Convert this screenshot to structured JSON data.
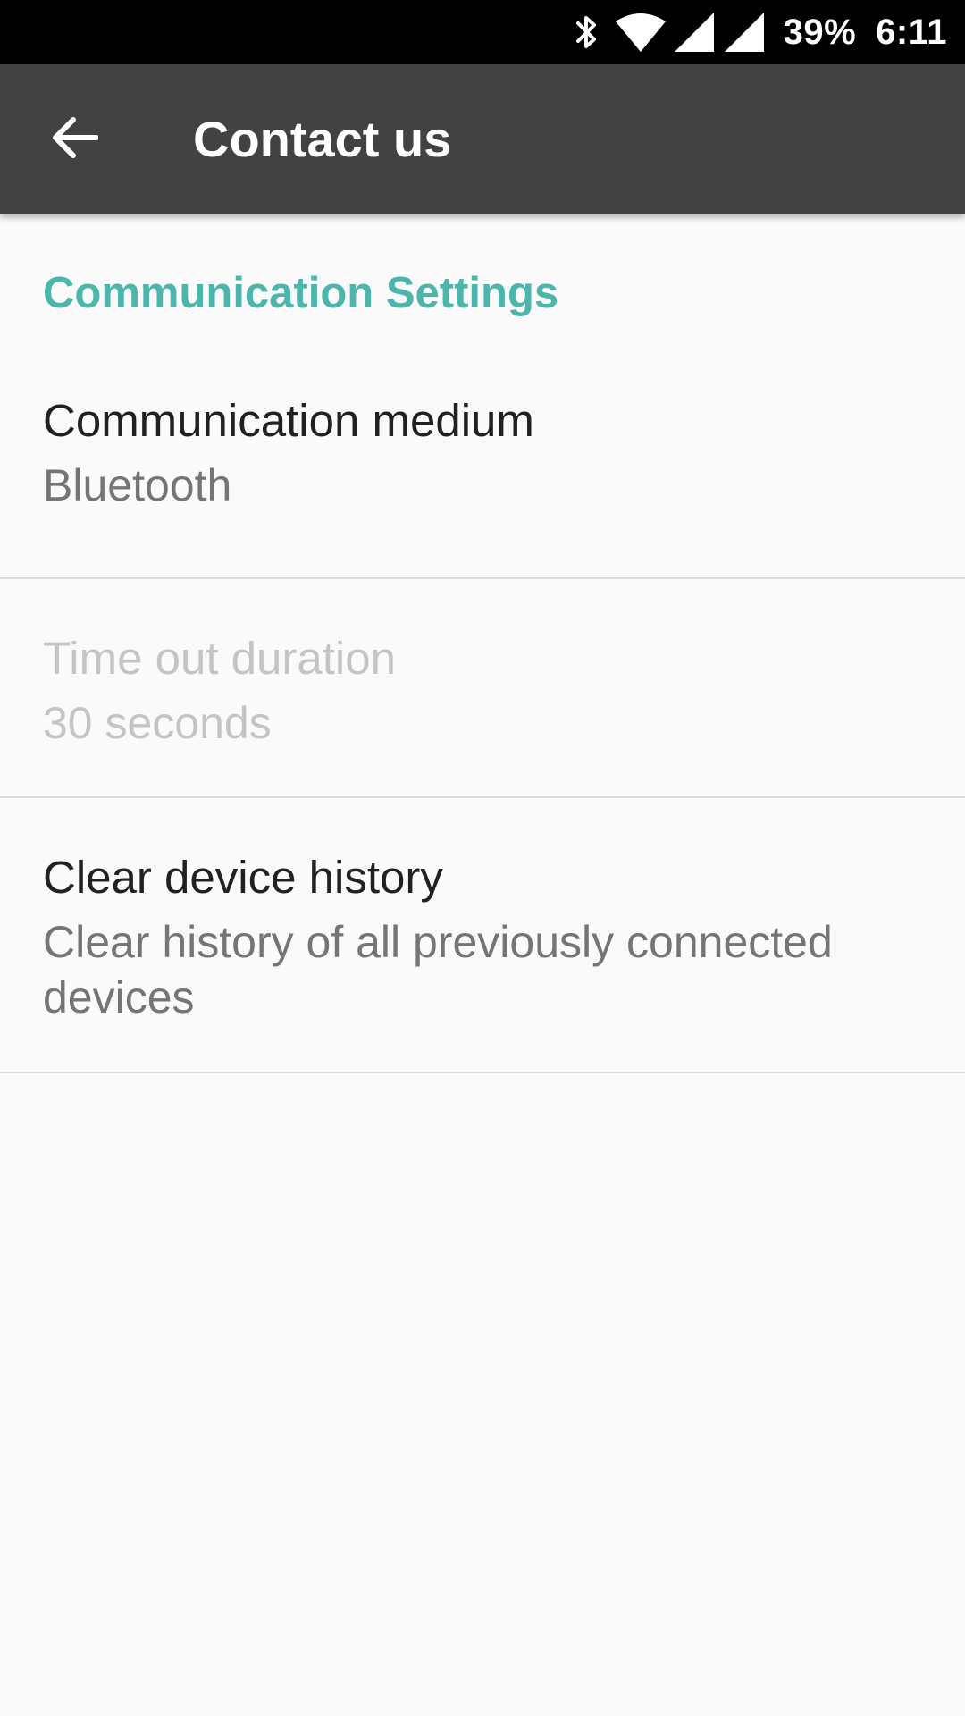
{
  "status_bar": {
    "battery": "39%",
    "time": "6:11",
    "icons": [
      "bluetooth-icon",
      "wifi-icon",
      "signal-icon",
      "signal-icon"
    ]
  },
  "app_bar": {
    "back_icon": "arrow-back-icon",
    "title": "Contact us",
    "background": "#424242"
  },
  "settings": {
    "section_title": "Communication Settings",
    "accent_color": "#4db6ac",
    "items": [
      {
        "title": "Communication medium",
        "summary": "Bluetooth",
        "enabled": true
      },
      {
        "title": "Time out duration",
        "summary": "30 seconds",
        "enabled": false
      },
      {
        "title": "Clear device history",
        "summary": "Clear history of all previously connected devices",
        "enabled": true
      }
    ]
  }
}
